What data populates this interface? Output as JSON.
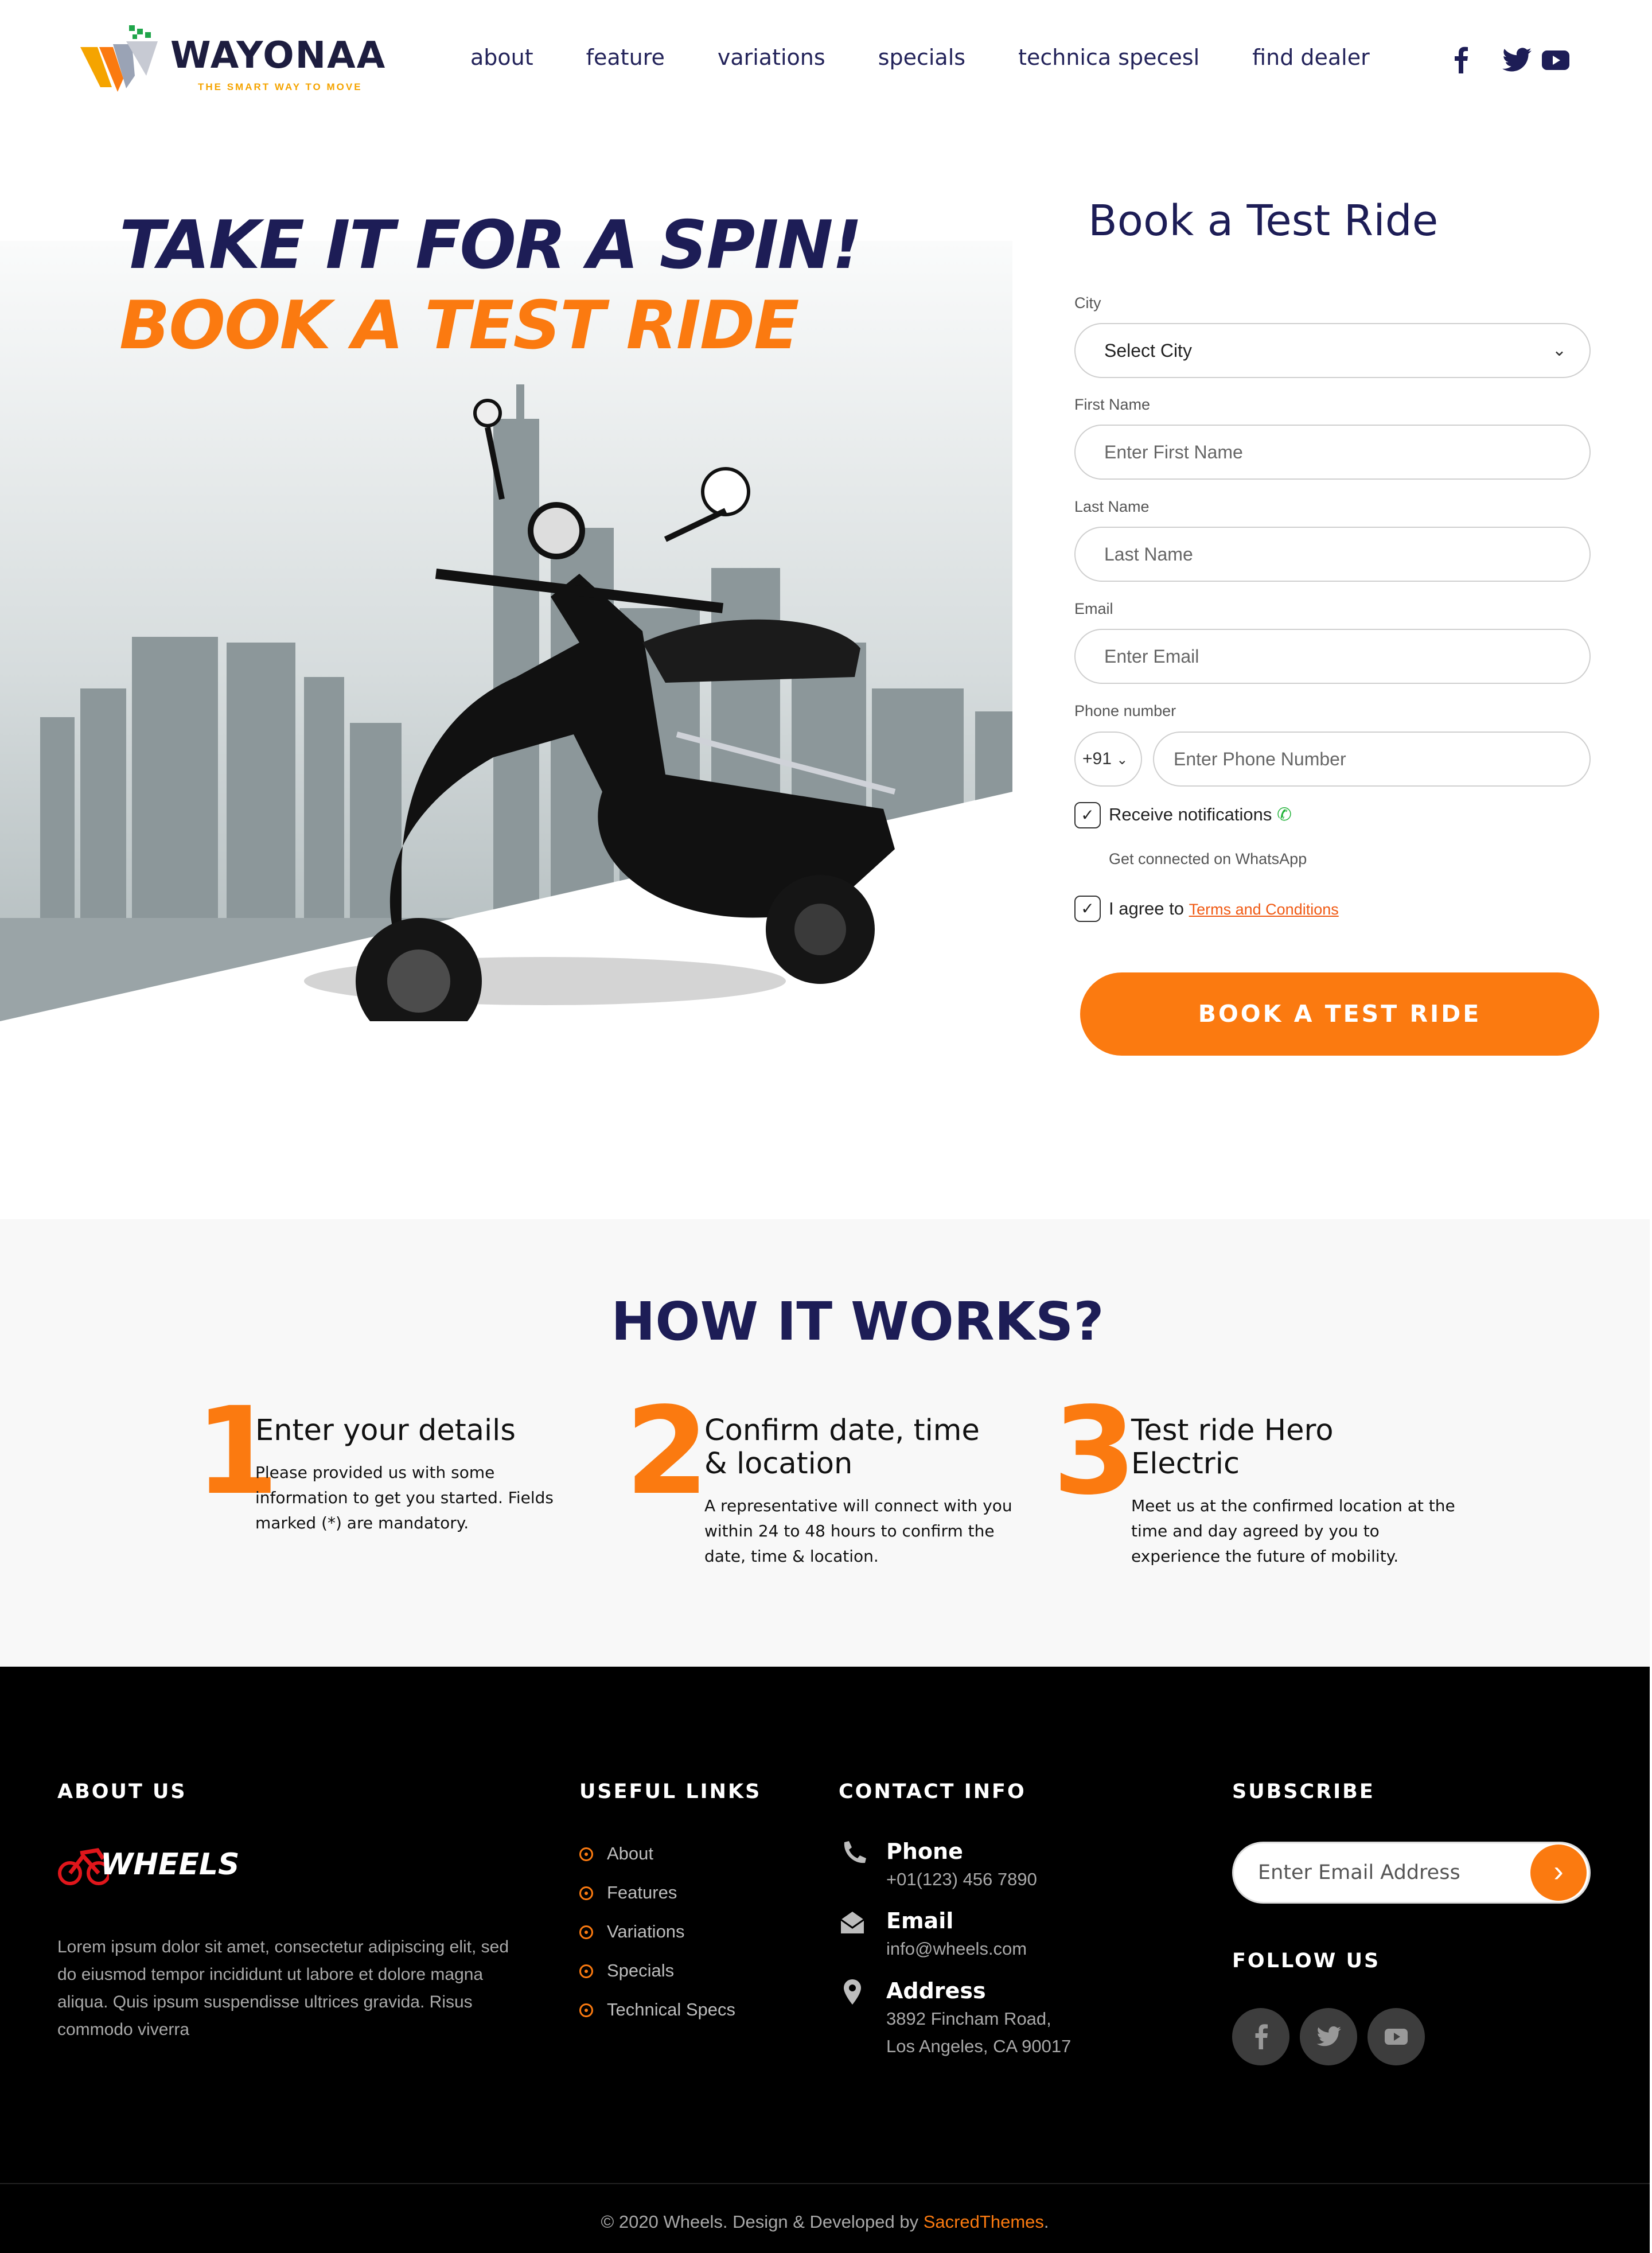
{
  "brand": {
    "name": "WAYONAA",
    "tagline": "THE SMART WAY TO MOVE"
  },
  "nav": [
    "about",
    "feature",
    "variations",
    "specials",
    "technica specesl",
    "find dealer"
  ],
  "social_top": [
    "facebook-icon",
    "twitter-icon",
    "youtube-icon"
  ],
  "hero": {
    "line1": "TAKE IT FOR A SPIN!",
    "line2": "BOOK A TEST RIDE"
  },
  "form": {
    "title": "Book a Test Ride",
    "city_label": "City",
    "city_value": "Select City",
    "first_label": "First Name",
    "first_placeholder": "Enter First Name",
    "last_label": "Last Name",
    "last_placeholder": "Last Name",
    "email_label": "Email",
    "email_placeholder": "Enter Email",
    "phone_label": "Phone number",
    "country_code": "+91",
    "phone_placeholder": "Enter Phone Number",
    "notify_label": "Receive notifications",
    "notify_sub": "Get connected on WhatsApp",
    "agree_label": "I agree to",
    "terms_link": "Terms and Conditions",
    "submit": "BOOK A TEST RIDE"
  },
  "how": {
    "title": "HOW IT WORKS?",
    "steps": [
      {
        "num": "1",
        "title": "Enter your details",
        "text": "Please provided us with some information to get you started. Fields marked (*) are mandatory."
      },
      {
        "num": "2",
        "title": "Confirm date, time & location",
        "text": "A representative will connect with you within 24 to 48 hours to confirm the date, time & location."
      },
      {
        "num": "3",
        "title": "Test ride Hero Electric",
        "text": "Meet us at the confirmed location at the time and day agreed by you to experience the future of mobility."
      }
    ]
  },
  "footer": {
    "about_title": "ABOUT US",
    "logo_text": "WHEELS",
    "about_text": "Lorem ipsum dolor sit amet, consectetur adipiscing elit, sed do eiusmod tempor incididunt ut labore et dolore magna aliqua. Quis ipsum suspendisse ultrices gravida. Risus commodo viverra",
    "links_title": "USEFUL LINKS",
    "links": [
      "About",
      "Features",
      "Variations",
      "Specials",
      "Technical Specs"
    ],
    "contact_title": "CONTACT INFO",
    "phone_label": "Phone",
    "phone": "+01(123) 456 7890",
    "email_label": "Email",
    "email": "info@wheels.com",
    "address_label": "Address",
    "address1": "3892 Fincham Road,",
    "address2": "Los Angeles, CA 90017",
    "subscribe_title": "SUBSCRIBE",
    "subscribe_placeholder": "Enter Email Address",
    "follow_title": "FOLLOW US",
    "copy_prefix": "© 2020 Wheels. Design & Developed by ",
    "copy_brand": "SacredThemes",
    "copy_suffix": "."
  },
  "colors": {
    "accent": "#fb7a10",
    "navy": "#1d1d56",
    "footer_bg": "#000000",
    "section_bg": "#f8f8f8"
  }
}
